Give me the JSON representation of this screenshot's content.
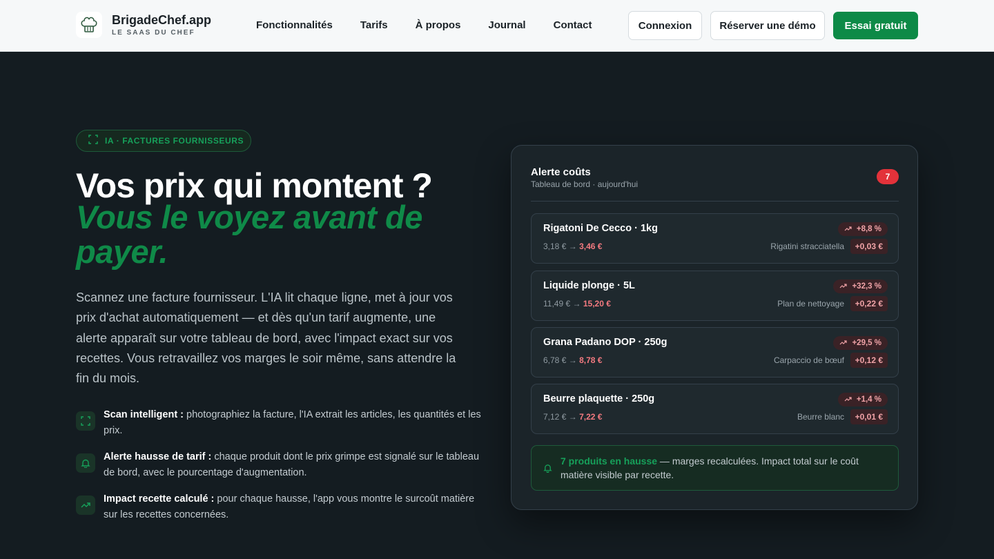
{
  "nav": {
    "brand_name": "BrigadeChef.app",
    "brand_tag": "LE SAAS DU CHEF",
    "logo_icon": "chef-hat-icon",
    "menu": [
      "Fonctionnalités",
      "Tarifs",
      "À propos",
      "Journal",
      "Contact"
    ],
    "login_label": "Connexion",
    "demo_label": "Réserver une démo",
    "trial_label": "Essai gratuit"
  },
  "hero": {
    "pill": "IA · FACTURES FOURNISSEURS",
    "title": "Vos prix qui montent ?",
    "title_accent": "Vous le voyez avant de payer.",
    "lead": "Scannez une facture fournisseur. L'IA lit chaque ligne, met à jour vos prix d'achat automatiquement — et dès qu'un tarif augmente, une alerte apparaît sur votre tableau de bord, avec l'impact exact sur vos recettes. Vous retravaillez vos marges le soir même, sans attendre la fin du mois.",
    "features": [
      {
        "icon": "scan-icon",
        "title": "Scan intelligent :",
        "text": " photographiez la facture, l'IA extrait les articles, les quantités et les prix."
      },
      {
        "icon": "bell-icon",
        "title": "Alerte hausse de tarif :",
        "text": " chaque produit dont le prix grimpe est signalé sur le tableau de bord, avec le pourcentage d'augmentation."
      },
      {
        "icon": "trend-up-icon",
        "title": "Impact recette calculé :",
        "text": " pour chaque hausse, l'app vous montre le surcoût matière sur les recettes concernées."
      }
    ]
  },
  "card": {
    "title": "Alerte coûts",
    "subtitle": "Tableau de bord · aujourd'hui",
    "badge": "7",
    "items": [
      {
        "name": "Rigatoni De Cecco · 1kg",
        "old": "3,18 €",
        "new": "3,46 €",
        "pct": "+8,8 %",
        "recipe": "Rigatini stracciatella",
        "impact": "+0,03 €"
      },
      {
        "name": "Liquide plonge · 5L",
        "old": "11,49 €",
        "new": "15,20 €",
        "pct": "+32,3 %",
        "recipe": "Plan de nettoyage",
        "impact": "+0,22 €"
      },
      {
        "name": "Grana Padano DOP · 250g",
        "old": "6,78 €",
        "new": "8,78 €",
        "pct": "+29,5 %",
        "recipe": "Carpaccio de bœuf",
        "impact": "+0,12 €"
      },
      {
        "name": "Beurre plaquette · 250g",
        "old": "7,12 €",
        "new": "7,22 €",
        "pct": "+1,4 %",
        "recipe": "Beurre blanc",
        "impact": "+0,01 €"
      }
    ],
    "arrow": "→",
    "alert_strong": "7 produits en hausse",
    "alert_text": " — marges recalculées. Impact total sur le coût matière visible par recette."
  },
  "colors": {
    "accent": "#0f8a48",
    "danger": "#e3323a",
    "background": "#141c21"
  }
}
